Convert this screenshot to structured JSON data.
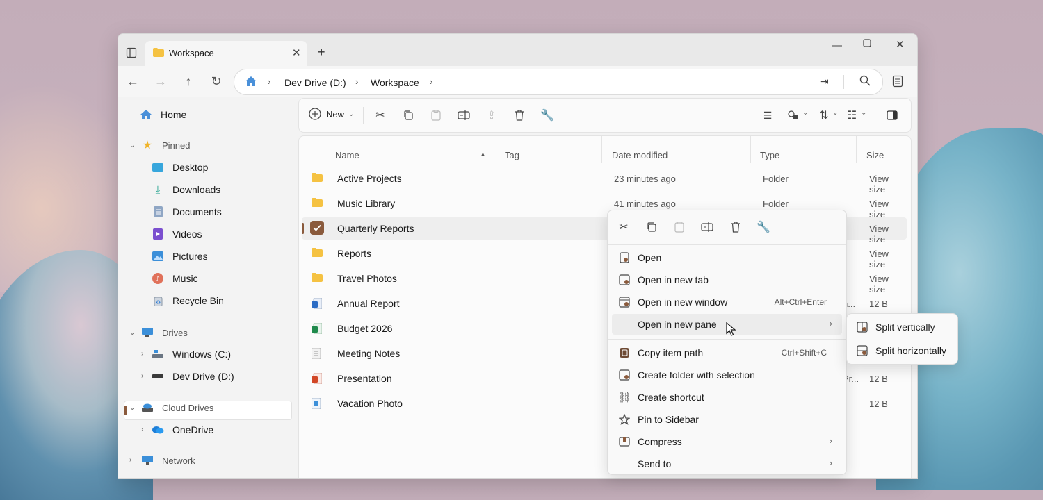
{
  "window": {
    "tab_title": "Workspace"
  },
  "address": {
    "crumbs": [
      "Dev Drive (D:)",
      "Workspace"
    ]
  },
  "toolbar": {
    "new_label": "New"
  },
  "sidebar": {
    "home": "Home",
    "pinned": "Pinned",
    "pinned_items": [
      "Desktop",
      "Downloads",
      "Documents",
      "Videos",
      "Pictures",
      "Music",
      "Recycle Bin"
    ],
    "drives": "Drives",
    "drive_items": [
      "Windows (C:)",
      "Dev Drive (D:)"
    ],
    "cloud": "Cloud Drives",
    "cloud_items": [
      "OneDrive"
    ],
    "network": "Network"
  },
  "columns": {
    "name": "Name",
    "tag": "Tag",
    "date": "Date modified",
    "type": "Type",
    "size": "Size"
  },
  "files": [
    {
      "name": "Active Projects",
      "date": "23 minutes ago",
      "type": "Folder",
      "size": "View size"
    },
    {
      "name": "Music Library",
      "date": "41 minutes ago",
      "type": "Folder",
      "size": "View size"
    },
    {
      "name": "Quarterly Reports",
      "date": "",
      "type": "",
      "size": "View size"
    },
    {
      "name": "Reports",
      "date": "",
      "type": "",
      "size": "View size"
    },
    {
      "name": "Travel Photos",
      "date": "",
      "type": "",
      "size": "View size"
    },
    {
      "name": "Annual Report",
      "date": "",
      "type": "h...",
      "size": "12 B"
    },
    {
      "name": "Budget 2026",
      "date": "",
      "type": "",
      "size": ""
    },
    {
      "name": "Meeting Notes",
      "date": "",
      "type": "",
      "size": ""
    },
    {
      "name": "Presentation",
      "date": "",
      "type": "Pr...",
      "size": "12 B"
    },
    {
      "name": "Vacation Photo",
      "date": "",
      "type": "",
      "size": "12 B"
    }
  ],
  "context_menu": {
    "items": [
      {
        "label": "Open",
        "shortcut": ""
      },
      {
        "label": "Open in new tab",
        "shortcut": ""
      },
      {
        "label": "Open in new window",
        "shortcut": "Alt+Ctrl+Enter"
      },
      {
        "label": "Open in new pane",
        "shortcut": ""
      },
      {
        "label": "Copy item path",
        "shortcut": "Ctrl+Shift+C"
      },
      {
        "label": "Create folder with selection",
        "shortcut": ""
      },
      {
        "label": "Create shortcut",
        "shortcut": ""
      },
      {
        "label": "Pin to Sidebar",
        "shortcut": ""
      },
      {
        "label": "Compress",
        "shortcut": ""
      },
      {
        "label": "Send to",
        "shortcut": ""
      }
    ]
  },
  "submenu": {
    "items": [
      "Split vertically",
      "Split horizontally"
    ]
  },
  "colors": {
    "accent": "#8a5a3c",
    "folder": "#f5c242",
    "home": "#4a90d9"
  }
}
